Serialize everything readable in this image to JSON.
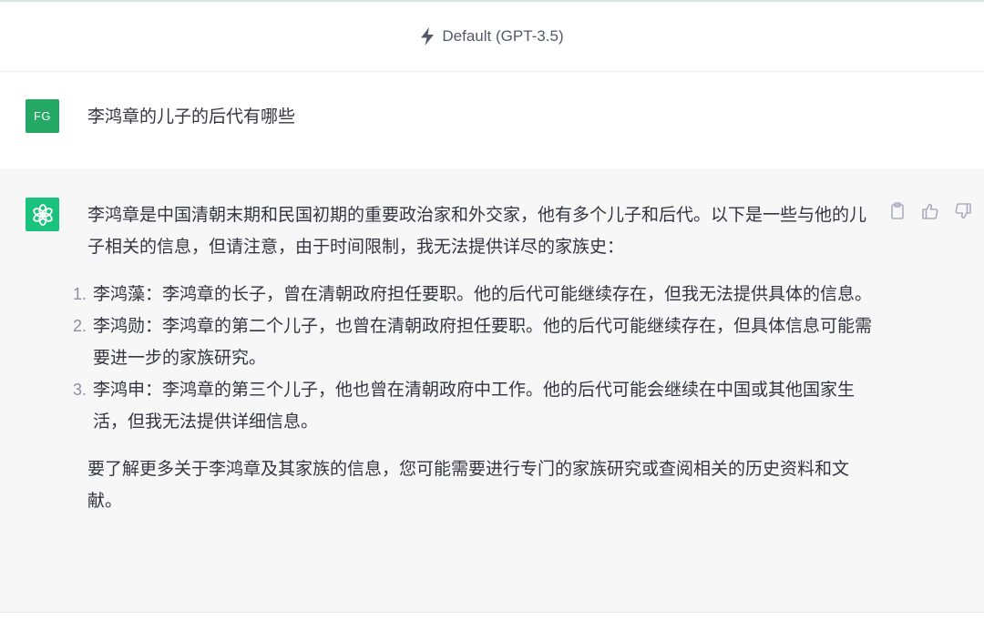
{
  "header": {
    "model_label": "Default (GPT-3.5)"
  },
  "user_message": {
    "avatar_initials": "FG",
    "text": "李鸿章的儿子的后代有哪些"
  },
  "assistant_message": {
    "intro": "李鸿章是中国清朝末期和民国初期的重要政治家和外交家，他有多个儿子和后代。以下是一些与他的儿子相关的信息，但请注意，由于时间限制，我无法提供详尽的家族史：",
    "items": [
      {
        "number": "1.",
        "text": "李鸿藻：李鸿章的长子，曾在清朝政府担任要职。他的后代可能继续存在，但我无法提供具体的信息。"
      },
      {
        "number": "2.",
        "text": "李鸿勋：李鸿章的第二个儿子，也曾在清朝政府担任要职。他的后代可能继续存在，但具体信息可能需要进一步的家族研究。"
      },
      {
        "number": "3.",
        "text": "李鸿申：李鸿章的第三个儿子，他也曾在清朝政府中工作。他的后代可能会继续在中国或其他国家生活，但我无法提供详细信息。"
      }
    ],
    "outro": "要了解更多关于李鸿章及其家族的信息，您可能需要进行专门的家族研究或查阅相关的历史资料和文献。"
  },
  "icons": {
    "model": "bolt-icon",
    "assistant_avatar": "openai-logo-icon",
    "copy": "clipboard-icon",
    "like": "thumbs-up-icon",
    "dislike": "thumbs-down-icon"
  },
  "colors": {
    "user_avatar": "#23a964",
    "assistant_avatar": "#19c37d",
    "assistant_bg": "#f7f7f8"
  }
}
